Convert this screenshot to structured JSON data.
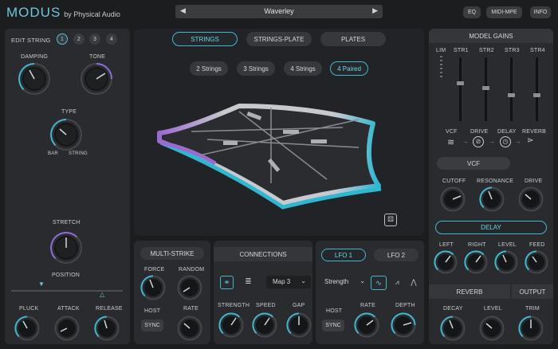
{
  "header": {
    "logo_main": "MODUS",
    "logo_by": "by Physical Audio",
    "preset_name": "Waverley",
    "buttons": [
      "EQ",
      "MIDI-MPE",
      "INFO"
    ]
  },
  "left": {
    "edit_string_label": "EDIT STRING",
    "string_nums": [
      "1",
      "2",
      "3",
      "4"
    ],
    "damping": "DAMPING",
    "tone": "TONE",
    "type": "TYPE",
    "type_bar": "BAR",
    "type_string": "STRING",
    "stretch": "STRETCH",
    "position": "POSITION",
    "pluck": "PLUCK",
    "attack": "ATTACK",
    "release": "RELEASE"
  },
  "center": {
    "tabs": [
      "STRINGS",
      "STRINGS-PLATE",
      "PLATES"
    ],
    "sub_tabs": [
      "2 Strings",
      "3 Strings",
      "4 Strings",
      "4 Paired"
    ]
  },
  "bottom": {
    "multistrike": "MULTI-STRIKE",
    "force": "FORCE",
    "random": "RANDOM",
    "host": "HOST",
    "sync": "SYNC",
    "rate": "RATE",
    "connections": "CONNECTIONS",
    "map": "Map 3",
    "strength": "STRENGTH",
    "speed": "SPEED",
    "gap": "GAP",
    "lfo1": "LFO 1",
    "lfo2": "LFO 2",
    "lfo_dest": "Strength",
    "lfo_host": "HOST",
    "lfo_sync": "SYNC",
    "lfo_rate": "RATE",
    "lfo_depth": "DEPTH"
  },
  "right": {
    "model_gains": "MODEL GAINS",
    "gain_labels": [
      "LIM",
      "STR1",
      "STR2",
      "STR3",
      "STR4"
    ],
    "fx_chain": [
      "VCF",
      "DRIVE",
      "DELAY",
      "REVERB"
    ],
    "vcf": "VCF",
    "cutoff": "CUTOFF",
    "resonance": "RESONANCE",
    "drive": "DRIVE",
    "delay": "DELAY",
    "left": "LEFT",
    "right": "RIGHT",
    "level": "LEVEL",
    "feed": "FEED",
    "reverb": "REVERB",
    "output": "OUTPUT",
    "decay": "DECAY",
    "rev_level": "LEVEL",
    "trim": "TRIM"
  },
  "colors": {
    "accent": "#3fb7cf",
    "purple": "#8e6bd6",
    "bg": "#1c1d1f",
    "panel": "#2a2b2e"
  }
}
